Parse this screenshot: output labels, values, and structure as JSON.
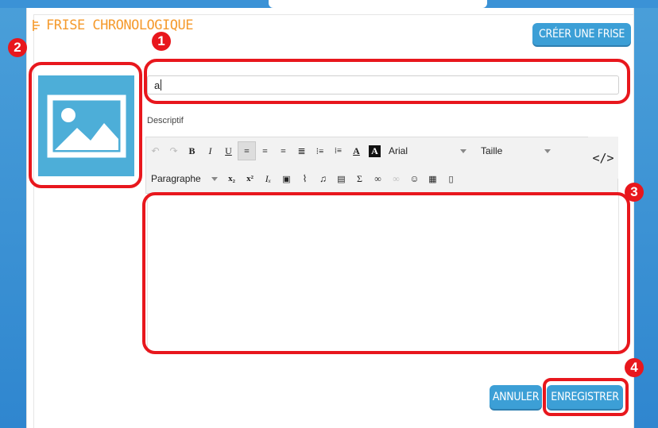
{
  "header": {
    "title": "FRISE CHRONOLOGIQUE",
    "create_label": "CRÉER UNE FRISE"
  },
  "form": {
    "title_value": "a",
    "description_label": "Descriptif",
    "editor_content": ""
  },
  "toolbar": {
    "font_family": "Arial",
    "font_size": "Taille",
    "format_block": "Paragraphe",
    "code_view": "</>"
  },
  "actions": {
    "cancel_label": "ANNULER",
    "save_label": "ENREGISTRER"
  },
  "markers": [
    "1",
    "2",
    "3",
    "4"
  ],
  "colors": {
    "accent_blue": "#3c9fd6",
    "title_orange": "#f59a2c",
    "highlight_red": "#e8171d"
  }
}
